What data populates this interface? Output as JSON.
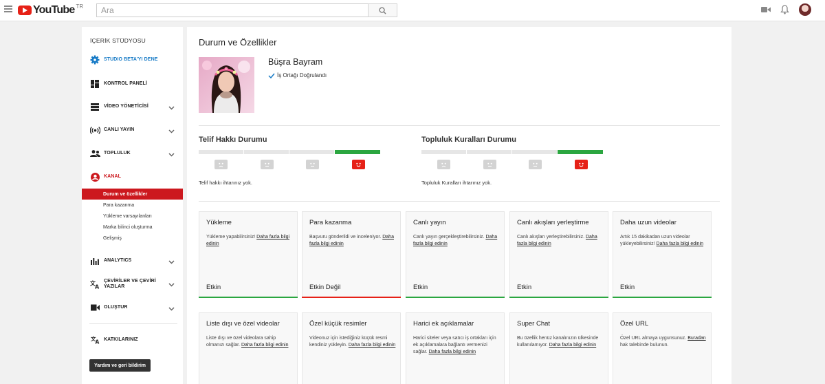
{
  "topbar": {
    "logo_text": "YouTube",
    "logo_region": "TR",
    "search_placeholder": "Ara"
  },
  "sidebar": {
    "title": "İÇERİK STÜDYOSU",
    "beta": "STUDIO BETA'YI DENE",
    "dashboard": "KONTROL PANELİ",
    "video_manager": "VİDEO YÖNETİCİSİ",
    "live": "CANLI YAYIN",
    "community": "TOPLULUK",
    "channel": "KANAL",
    "channel_sub": [
      "Durum ve özellikler",
      "Para kazanma",
      "Yükleme varsayılanları",
      "Marka bilinci oluşturma",
      "Gelişmiş"
    ],
    "analytics": "ANALYTICS",
    "translations_line1": "ÇEVİRİLER VE ÇEVİRİ",
    "translations_line2": "YAZILAR",
    "create": "OLUŞTUR",
    "contributions": "KATKILARINIZ",
    "help_button": "Yardım ve geri bildirim"
  },
  "main": {
    "title": "Durum ve Özellikler",
    "channel_name": "Büşra Bayram",
    "verified_label": "İş Ortağı Doğrulandı",
    "copyright": {
      "title": "Telif Hakkı Durumu",
      "note": "Telif hakkı ihtarınız yok."
    },
    "community_guidelines": {
      "title": "Topluluk Kuralları Durumu",
      "note": "Topluluk Kuralları ihtarınız yok."
    },
    "cards_row1": [
      {
        "title": "Yükleme",
        "desc": "Yükleme yapabilirsiniz! ",
        "link": "Daha fazla bilgi edinin",
        "status": "Etkin",
        "color": "#2ba640"
      },
      {
        "title": "Para kazanma",
        "desc": "Başvuru gönderildi ve inceleniyor. ",
        "link": "Daha fazla bilgi edinin",
        "status": "Etkin Değil",
        "color": "#e62117"
      },
      {
        "title": "Canlı yayın",
        "desc": "Canlı yayın gerçekleştirebilirsiniz. ",
        "link": "Daha fazla bilgi edinin",
        "status": "Etkin",
        "color": "#2ba640"
      },
      {
        "title": "Canlı akışları yerleştirme",
        "desc": "Canlı akışları yerleştirebilirsiniz. ",
        "link": "Daha fazla bilgi edinin",
        "status": "Etkin",
        "color": "#2ba640"
      },
      {
        "title": "Daha uzun videolar",
        "desc": "Artık 15 dakikadan uzun videolar yükleyebilirsiniz! ",
        "link": "Daha fazla bilgi edinin",
        "status": "Etkin",
        "color": "#2ba640"
      }
    ],
    "cards_row2": [
      {
        "title": "Liste dışı ve özel videolar",
        "desc": "Liste dışı ve özel videolara sahip olmanızı sağlar. ",
        "link": "Daha fazla bilgi edinin"
      },
      {
        "title": "Özel küçük resimler",
        "desc": "Videonuz için istediğiniz küçük resmi kendiniz yükleyin. ",
        "link": "Daha fazla bilgi edinin"
      },
      {
        "title": "Harici ek açıklamalar",
        "desc": "Harici siteler veya satıcı iş ortakları için ek açıklamalara bağlantı vermenizi sağlar. ",
        "link": "Daha fazla bilgi edinin"
      },
      {
        "title": "Super Chat",
        "desc": "Bu özellik henüz kanalınızın ülkesinde kullanılamıyor. ",
        "link": "Daha fazla bilgi edinin"
      },
      {
        "title": "Özel URL",
        "desc": "Özel URL almaya uygunsunuz. ",
        "link": "Buradan",
        "desc_after": " hak talebinde bulunun."
      }
    ]
  },
  "colors": {
    "brand_red": "#e62117",
    "sidebar_active": "#cc181e",
    "enabled_green": "#2ba640",
    "beta_blue": "#167ac6"
  }
}
